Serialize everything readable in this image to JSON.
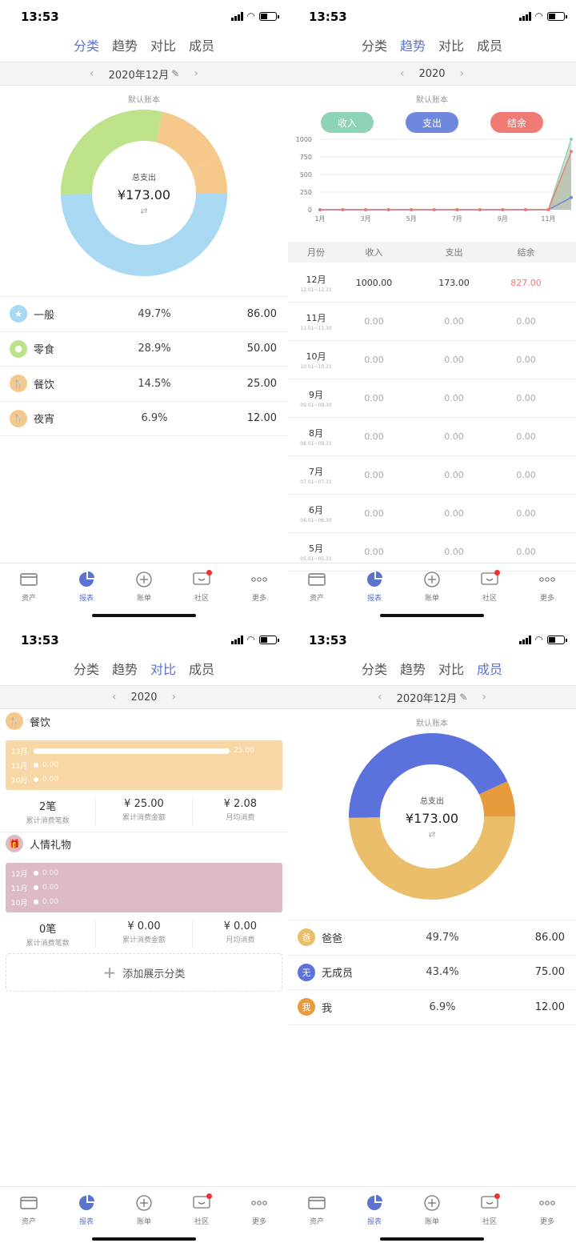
{
  "status": {
    "time": "13:53"
  },
  "tabs": [
    "分类",
    "趋势",
    "对比",
    "成员"
  ],
  "book": "默认账本",
  "nav": [
    {
      "label": "资产",
      "icon": "card-icon"
    },
    {
      "label": "报表",
      "icon": "pie-chart-icon"
    },
    {
      "label": "账单",
      "icon": "add-circle-icon"
    },
    {
      "label": "社区",
      "icon": "chat-icon"
    },
    {
      "label": "更多",
      "icon": "more-icon"
    }
  ],
  "colors": {
    "accent": "#5b72cf",
    "blue": "#a9d8f3",
    "green": "#bde28a",
    "orange": "#f5c98b",
    "income": "#8fd3b6",
    "expense": "#6f87dc",
    "balance": "#ef7b74",
    "pink": "#dcbbc6",
    "gold": "#eabe6a",
    "navy": "#5b72dc",
    "amber": "#e79b3c"
  },
  "p1": {
    "date": "2020年12月",
    "center_label": "总支出",
    "center_amount": "¥173.00",
    "swap": "⇄",
    "rows": [
      {
        "icon": "star-icon",
        "glyph": "★",
        "name": "一般",
        "pct": "49.7%",
        "val": "86.00",
        "color": "#a9d8f3"
      },
      {
        "icon": "lollipop-icon",
        "glyph": "●",
        "name": "零食",
        "pct": "28.9%",
        "val": "50.00",
        "color": "#bde28a"
      },
      {
        "icon": "utensils-icon",
        "glyph": "🍴",
        "name": "餐饮",
        "pct": "14.5%",
        "val": "25.00",
        "color": "#f5c98b"
      },
      {
        "icon": "utensils-icon",
        "glyph": "🍴",
        "name": "夜宵",
        "pct": "6.9%",
        "val": "12.00",
        "color": "#f5c98b"
      }
    ]
  },
  "p2": {
    "date": "2020",
    "pills": {
      "income": "收入",
      "expense": "支出",
      "balance": "结余"
    },
    "yticks": [
      "0",
      "250",
      "500",
      "750",
      "1000"
    ],
    "xticks": [
      "1月",
      "3月",
      "5月",
      "7月",
      "9月",
      "11月"
    ],
    "headers": [
      "月份",
      "收入",
      "支出",
      "结余"
    ],
    "rows": [
      {
        "m": "12月",
        "r": "12.01~12.31",
        "inc": "1000.00",
        "exp": "173.00",
        "bal": "827.00"
      },
      {
        "m": "11月",
        "r": "11.01~11.30",
        "inc": "0.00",
        "exp": "0.00",
        "bal": "0.00"
      },
      {
        "m": "10月",
        "r": "10.01~10.31",
        "inc": "0.00",
        "exp": "0.00",
        "bal": "0.00"
      },
      {
        "m": "9月",
        "r": "09.01~09.30",
        "inc": "0.00",
        "exp": "0.00",
        "bal": "0.00"
      },
      {
        "m": "8月",
        "r": "08.01~08.31",
        "inc": "0.00",
        "exp": "0.00",
        "bal": "0.00"
      },
      {
        "m": "7月",
        "r": "07.01~07.31",
        "inc": "0.00",
        "exp": "0.00",
        "bal": "0.00"
      },
      {
        "m": "6月",
        "r": "06.01~06.30",
        "inc": "0.00",
        "exp": "0.00",
        "bal": "0.00"
      },
      {
        "m": "5月",
        "r": "05.01~05.31",
        "inc": "0.00",
        "exp": "0.00",
        "bal": "0.00"
      }
    ]
  },
  "chart_data": [
    {
      "type": "pie",
      "categories": [
        "一般",
        "零食",
        "餐饮",
        "夜宵"
      ],
      "values": [
        86,
        50,
        25,
        12
      ],
      "title": "总支出"
    },
    {
      "type": "line",
      "x": [
        "1月",
        "2月",
        "3月",
        "4月",
        "5月",
        "6月",
        "7月",
        "8月",
        "9月",
        "10月",
        "11月",
        "12月"
      ],
      "series": [
        {
          "name": "收入",
          "values": [
            0,
            0,
            0,
            0,
            0,
            0,
            0,
            0,
            0,
            0,
            0,
            1000
          ]
        },
        {
          "name": "支出",
          "values": [
            0,
            0,
            0,
            0,
            0,
            0,
            0,
            0,
            0,
            0,
            0,
            173
          ]
        },
        {
          "name": "结余",
          "values": [
            0,
            0,
            0,
            0,
            0,
            0,
            0,
            0,
            0,
            0,
            0,
            827
          ]
        }
      ],
      "ylim": [
        0,
        1000
      ]
    },
    {
      "type": "pie",
      "categories": [
        "爸爸",
        "无成员",
        "我"
      ],
      "values": [
        86,
        75,
        12
      ],
      "title": "总支出"
    }
  ],
  "p3": {
    "date": "2020",
    "groups": [
      {
        "name": "餐饮",
        "glyph": "🍴",
        "icon": "utensils-icon",
        "color": "#f5c98b",
        "box": "#f8d7a7",
        "lines": [
          {
            "m": "12月",
            "v": "25.00",
            "frac": 1
          },
          {
            "m": "11月",
            "v": "0.00",
            "frac": 0
          },
          {
            "m": "10月",
            "v": "0.00",
            "frac": 0
          }
        ],
        "stats": [
          {
            "n": "2笔",
            "l": "累计消费笔数"
          },
          {
            "n": "¥ 25.00",
            "l": "累计消费金额"
          },
          {
            "n": "¥ 2.08",
            "l": "月均消费"
          }
        ]
      },
      {
        "name": "人情礼物",
        "glyph": "🎁",
        "icon": "gift-icon",
        "color": "#dcbbc6",
        "box": "#dcbbc6",
        "lines": [
          {
            "m": "12月",
            "v": "0.00",
            "frac": 0
          },
          {
            "m": "11月",
            "v": "0.00",
            "frac": 0
          },
          {
            "m": "10月",
            "v": "0.00",
            "frac": 0
          }
        ],
        "stats": [
          {
            "n": "0笔",
            "l": "累计消费笔数"
          },
          {
            "n": "¥ 0.00",
            "l": "累计消费金额"
          },
          {
            "n": "¥ 0.00",
            "l": "月均消费"
          }
        ]
      }
    ],
    "add": "添加展示分类"
  },
  "p4": {
    "date": "2020年12月",
    "center_label": "总支出",
    "center_amount": "¥173.00",
    "swap": "⇄",
    "rows": [
      {
        "glyph": "爸",
        "name": "爸爸",
        "pct": "49.7%",
        "val": "86.00",
        "color": "#eabe6a"
      },
      {
        "glyph": "无",
        "name": "无成员",
        "pct": "43.4%",
        "val": "75.00",
        "color": "#5b72dc"
      },
      {
        "glyph": "我",
        "name": "我",
        "pct": "6.9%",
        "val": "12.00",
        "color": "#e79b3c"
      }
    ]
  }
}
